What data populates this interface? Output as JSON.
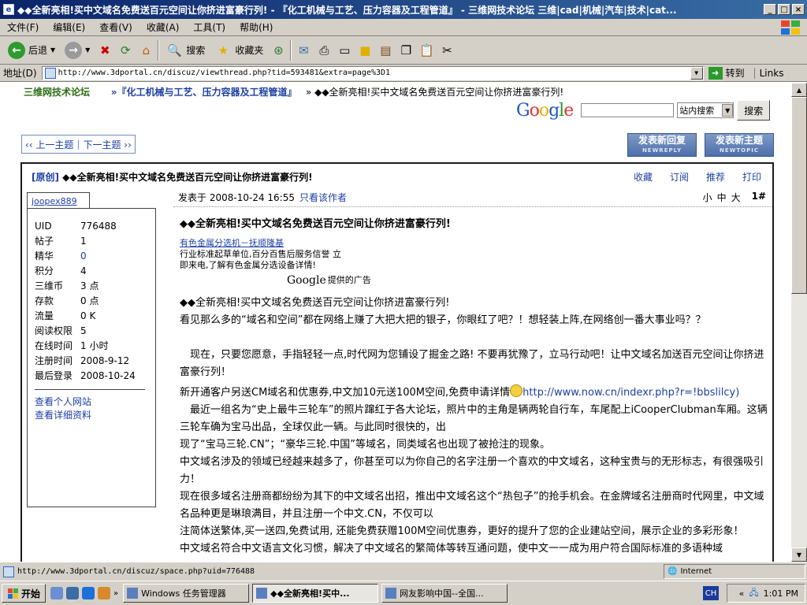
{
  "window": {
    "title": "◆◆全新亮相!买中文域名免费送百元空间让你挤进富豪行列! - 『化工机械与工艺、压力容器及工程管道』 - 三维网技术论坛 三维|cad|机械|汽车|技术|cat..."
  },
  "menu": [
    "文件(F)",
    "编辑(E)",
    "查看(V)",
    "收藏(A)",
    "工具(T)",
    "帮助(H)"
  ],
  "toolbar": {
    "back": "后退",
    "search": "搜索",
    "favorites": "收藏夹"
  },
  "address": {
    "label": "地址(D)",
    "url": "http://www.3dportal.cn/discuz/viewthread.php?tid=593481&extra=page%3D1",
    "go": "转到",
    "links": "Links"
  },
  "breadcrumb": {
    "home": "三维网技术论坛",
    "forum": "»『化工机械与工艺、压力容器及工程管道』",
    "thread": "» ◆◆全新亮相!买中文域名免费送百元空间让你挤进富豪行列!"
  },
  "google": {
    "logo": "Google",
    "select": "站内搜索",
    "button": "搜索"
  },
  "pager": {
    "prev": "‹‹ 上一主题",
    "next": "下一主题 ››"
  },
  "buttons": {
    "reply": "发表新回复",
    "reply_en": "NEWREPLY",
    "topic": "发表新主题",
    "topic_en": "NEWTOPIC"
  },
  "post": {
    "tag": "[原创]",
    "subject": "◆◆全新亮相!买中文域名免费送百元空间让你挤进富豪行列!",
    "actions": [
      "收藏",
      "订阅",
      "推荐",
      "打印"
    ],
    "author": "joopex889",
    "profile": [
      {
        "k": "UID",
        "v": "776488",
        "link": false
      },
      {
        "k": "帖子",
        "v": "1",
        "link": false
      },
      {
        "k": "精华",
        "v": "0",
        "link": true
      },
      {
        "k": "积分",
        "v": "4",
        "link": false
      },
      {
        "k": "三维币",
        "v": "3 点",
        "link": false
      },
      {
        "k": "存款",
        "v": "0 点",
        "link": false
      },
      {
        "k": "流量",
        "v": "0 K",
        "link": false
      },
      {
        "k": "阅读权限",
        "v": "5",
        "link": false
      },
      {
        "k": "在线时间",
        "v": "1 小时",
        "link": false
      },
      {
        "k": "注册时间",
        "v": "2008-9-12",
        "link": false
      },
      {
        "k": "最后登录",
        "v": "2008-10-24",
        "link": false
      }
    ],
    "profile_links": [
      "查看个人网站",
      "查看详细资料"
    ],
    "posted_label": "发表于",
    "posted_time": "2008-10-24 16:55",
    "only_author": "只看该作者",
    "font_sizes": [
      "小",
      "中",
      "大"
    ],
    "floor": "1#",
    "title": "◆◆全新亮相!买中文域名免费送百元空间让你挤进富豪行列!",
    "ad": {
      "link": "有色金属分选机－抚顺隆基",
      "line1": "行业标准起草单位,百分百售后服务信誉 立",
      "line2": "即来电,了解有色金属分选设备详情!",
      "google": "Google",
      "provided": "提供的广告"
    },
    "p1": "◆◆全新亮相!买中文域名免费送百元空间让你挤进富豪行列!",
    "p2": "看见那么多的“域名和空间”都在网络上赚了大把大把的银子，你眼红了吧？！想轻装上阵,在网络创一番大事业吗？？",
    "p3": "现在，只要您愿意，手指轻轻一点,时代网为您铺设了掘金之路! 不要再犹豫了，立马行动吧！让中文域名加送百元空间让你挤进富豪行列！",
    "p4a": "新开通客户另送CM域名和优惠券,中文加10元送100M空间,免费申请详情",
    "p4url": "http://www.now.cn/indexr.php?r=!bbslilcy)",
    "p5": "最近一组名为“史上最牛三轮车”的照片蹿红于各大论坛，照片中的主角是辆两轮自行车，车尾配上iCooperClubman车厢。这辆三轮车确为宝马出品，全球仅此一辆。与此同时很快的，出",
    "p6": "现了“宝马三轮.CN”；“豪华三轮.中国”等域名，同类域名也出现了被抢注的现象。",
    "p7": "中文域名涉及的领域已经越来越多了，你甚至可以为你自己的名字注册一个喜欢的中文域名，这种宝贵与的无形标志，有很强吸引力！",
    "p8": "现在很多域名注册商都纷纷为其下的中文域名出招，推出中文域名这个“热包子”的抢手机会。在金牌域名注册商时代网里，中文域名品种更是琳琅满目，并且注册一个中文.CN，不仅可以",
    "p9": "注简体送繁体,买一送四,免费试用, 还能免费获赠100M空间优惠券，更好的提升了您的企业建站空间，展示企业的多彩形象！",
    "p10": "中文域名符合中文语言文化习惯，解决了中文域名的繁简体等转互通问题，使中文一一成为用户符合国际标准的多语种域"
  },
  "status": {
    "url": "http://www.3dportal.cn/discuz/space.php?uid=776488",
    "zone": "Internet"
  },
  "taskbar": {
    "start": "开始",
    "tasks": [
      "Windows 任务管理器",
      "◆◆全新亮相!买中...",
      "网友影响中国--全国..."
    ],
    "ime": "CH",
    "clock": "1:01 PM"
  }
}
